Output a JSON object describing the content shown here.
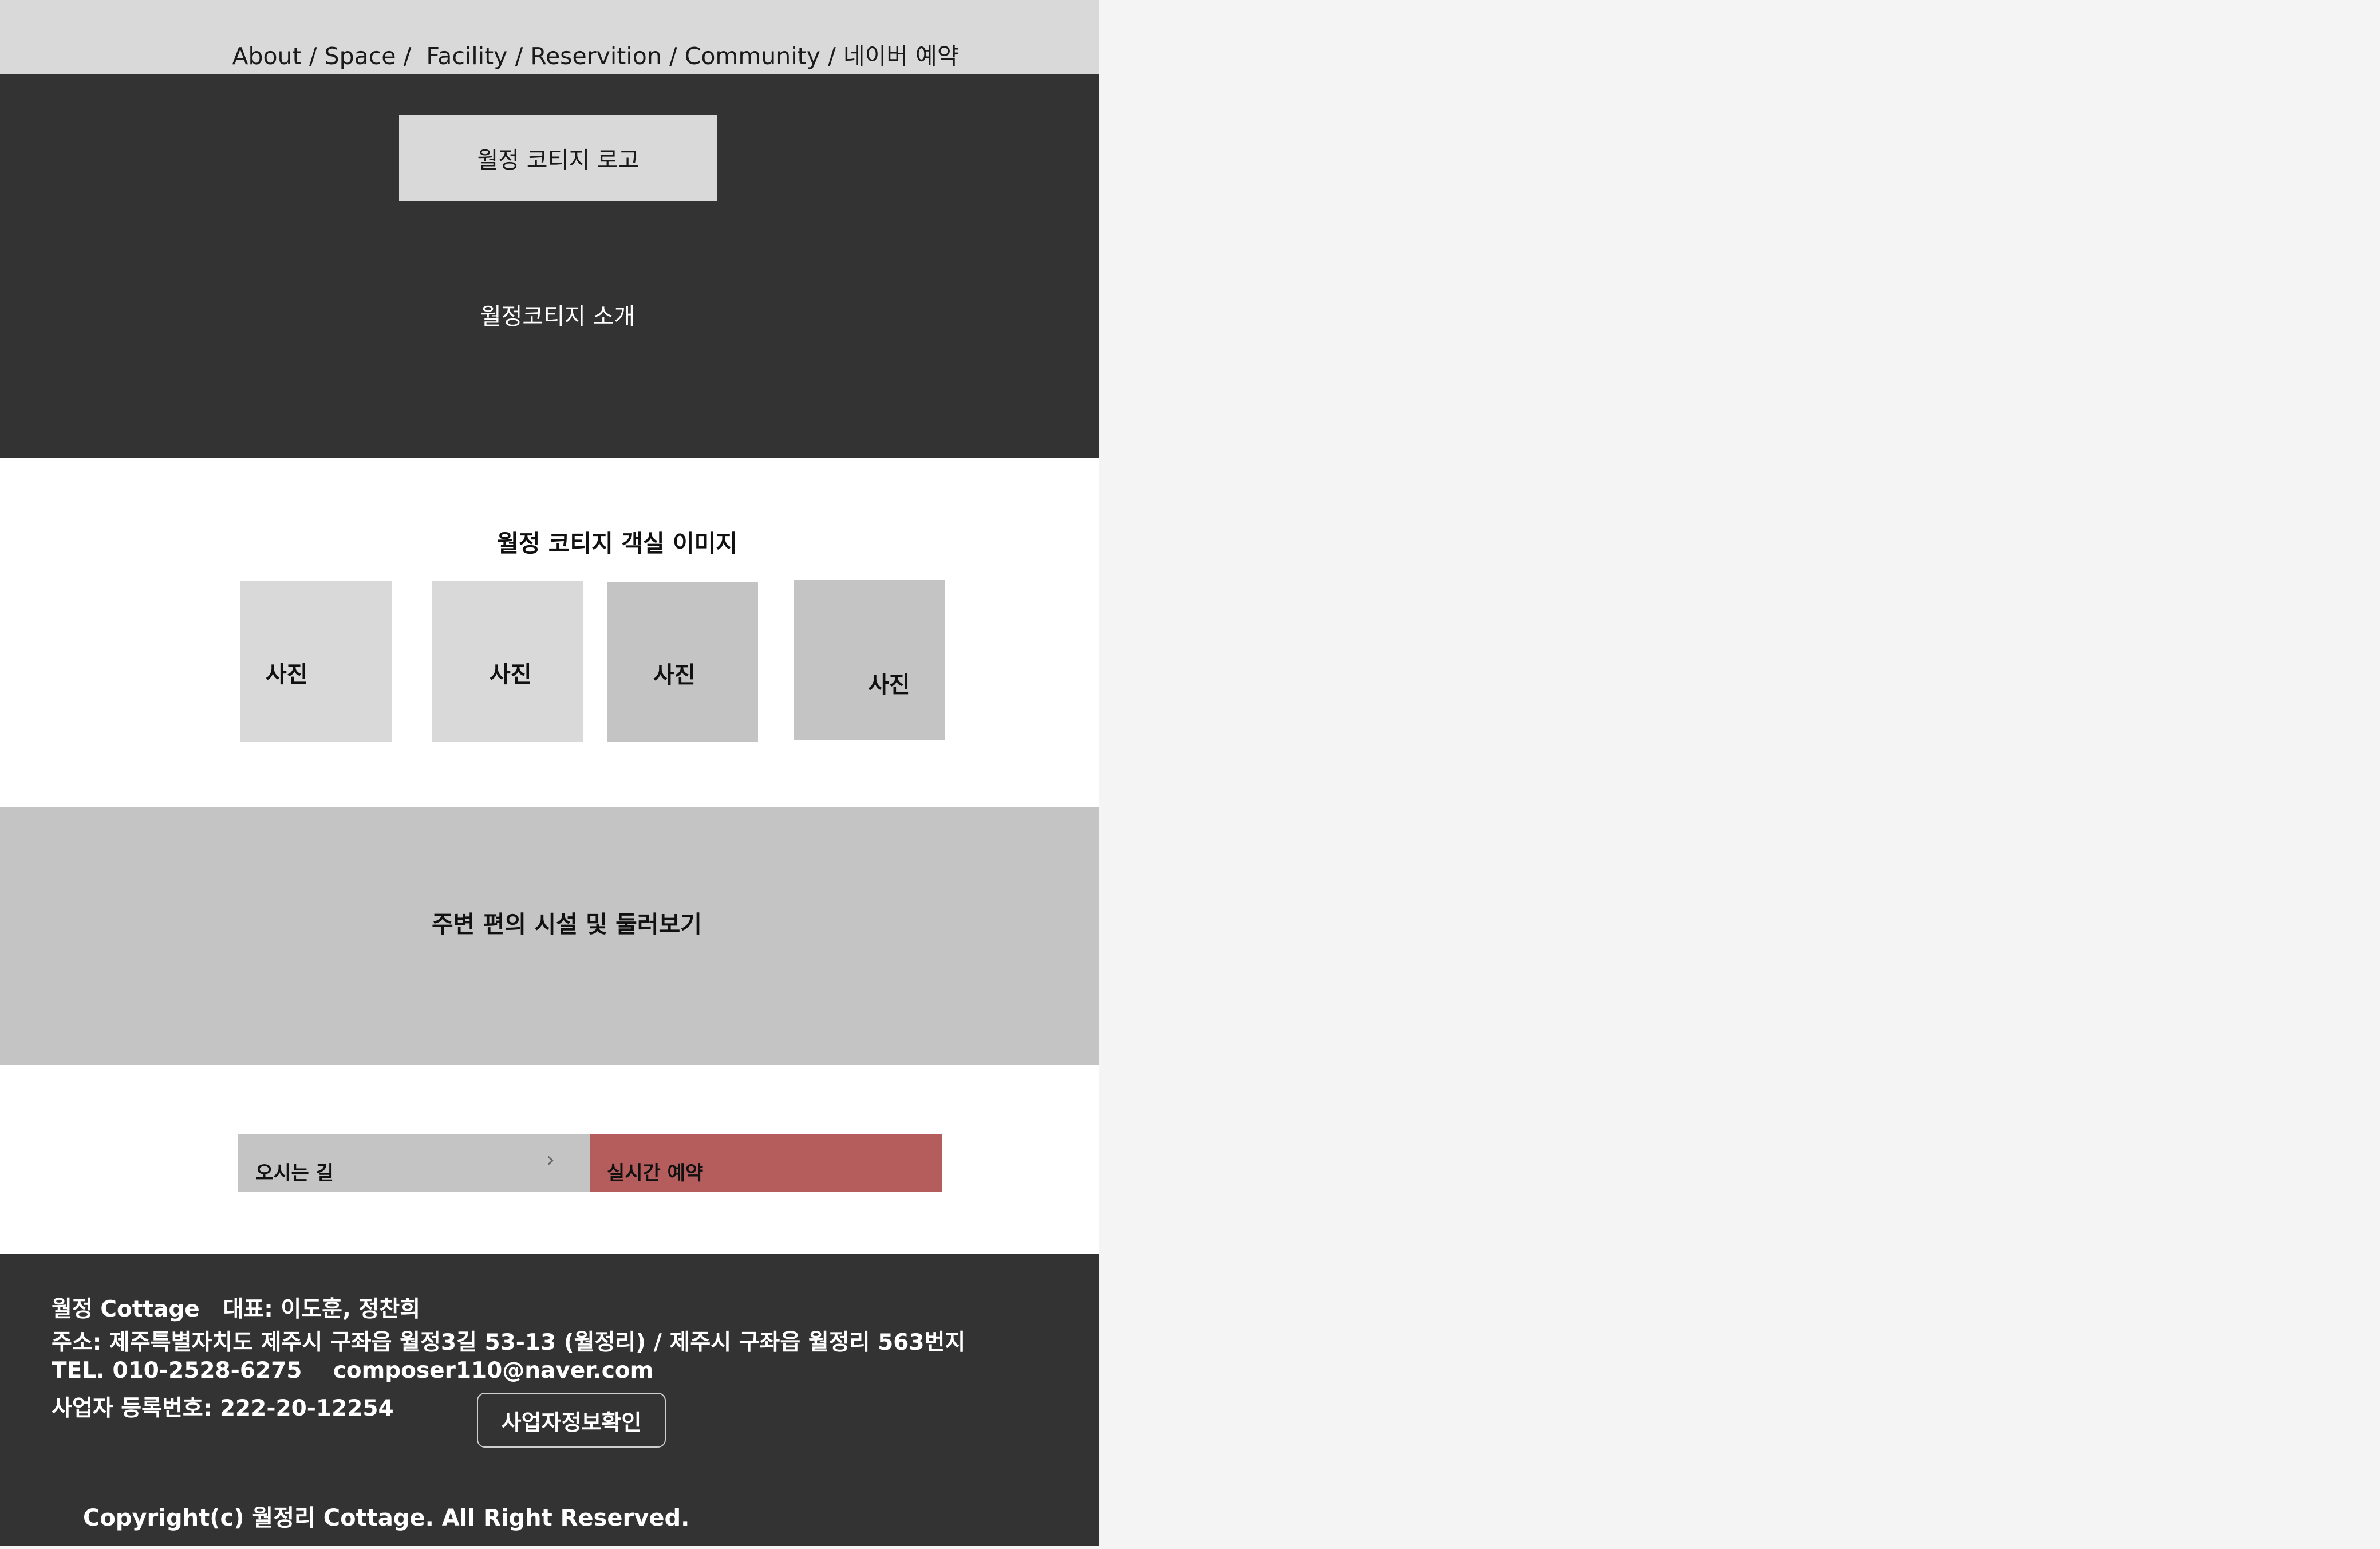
{
  "nav": {
    "items": [
      {
        "label": "About"
      },
      {
        "label": "Space"
      },
      {
        "label": "Facility"
      },
      {
        "label": "Reservition"
      },
      {
        "label": "Community"
      },
      {
        "label": "네이버 예약"
      }
    ],
    "sep": " / ",
    "sep_space": " /  "
  },
  "hero": {
    "logo_label": "월정 코티지 로고",
    "intro_text": "월정코티지 소개"
  },
  "gallery": {
    "title": "월정 코티지 객실 이미지",
    "photos": [
      "사진",
      "사진",
      "사진",
      "사진"
    ]
  },
  "surroundings": {
    "label": "주변 편의 시설 및 둘러보기"
  },
  "actions": {
    "directions_label": "오시는 길",
    "reservation_label": "실시간 예약",
    "chevron": "›"
  },
  "footer": {
    "name": "월정 Cottage",
    "rep": "대표: 이도훈, 정찬희",
    "address": "주소: 제주특별자치도 제주시 구좌읍 월정3길 53-13 (월정리) / 제주시 구좌읍 월정리 563번지",
    "tel": "TEL. 010-2528-6275",
    "email": "composer110@naver.com",
    "biz_no": "사업자 등록번호: 222-20-12254",
    "biz_button": "사업자정보확인",
    "copyright": "Copyright(c) 월정리 Cottage. All Right Reserved."
  },
  "colors": {
    "nav_bg": "#d9d9d9",
    "dark_bg": "#333333",
    "gray_block": "#c4c4c4",
    "accent_red": "#b55c5c",
    "side_bg": "#f4f4f4"
  }
}
